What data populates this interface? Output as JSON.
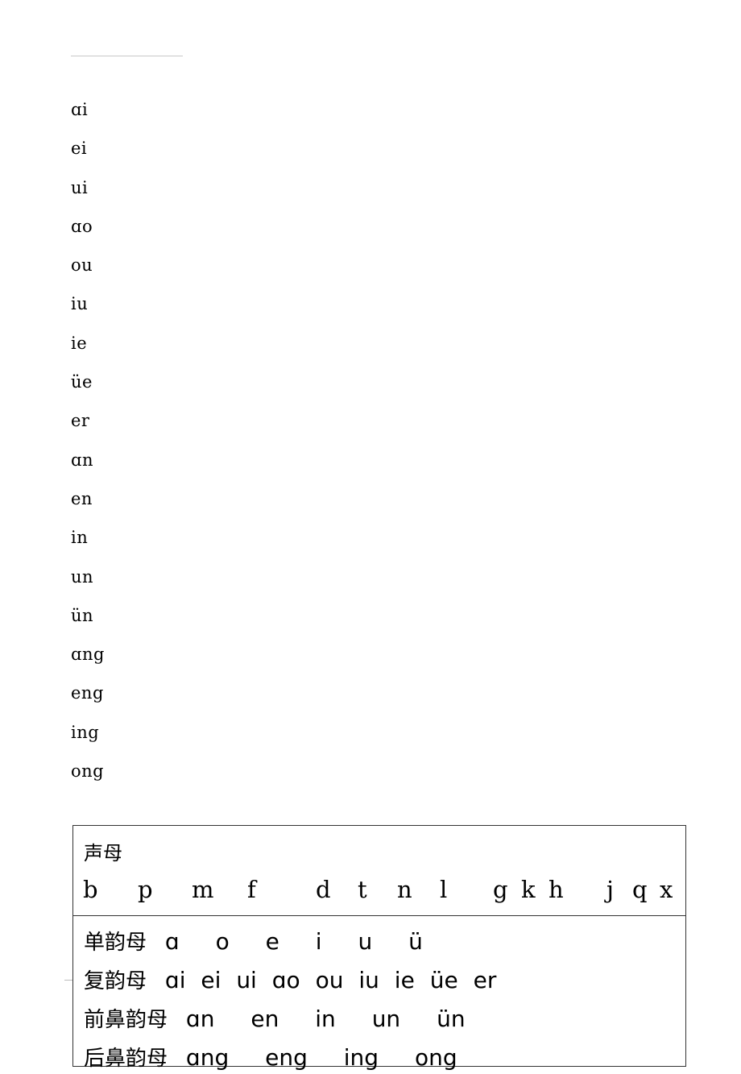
{
  "finals_list": [
    "ɑi",
    "ei",
    "ui",
    "ɑo",
    "ou",
    "iu",
    "ie",
    "üe",
    "er",
    "ɑn",
    "en",
    "in",
    "un",
    "ün",
    "ɑng",
    "eng",
    "ing",
    "ong"
  ],
  "chart": {
    "initials": {
      "title": "声母",
      "letters": [
        "b",
        "p",
        "m",
        "f",
        "d",
        "t",
        "n",
        "l",
        "g",
        "k",
        "h",
        "j",
        "q",
        "x"
      ]
    },
    "finals": [
      {
        "label": "单韵母",
        "items": [
          "ɑ",
          "o",
          "e",
          "i",
          "u",
          "ü"
        ]
      },
      {
        "label": "复韵母",
        "items": [
          "ɑi",
          "ei",
          "ui",
          "ɑo",
          "ou",
          "iu",
          "ie",
          "üe",
          "er"
        ]
      },
      {
        "label": "前鼻韵母",
        "items": [
          "ɑn",
          "en",
          "in",
          "un",
          "ün"
        ]
      },
      {
        "label": "后鼻韵母",
        "items": [
          "ɑng",
          "eng",
          "ing",
          "ong"
        ]
      }
    ]
  }
}
